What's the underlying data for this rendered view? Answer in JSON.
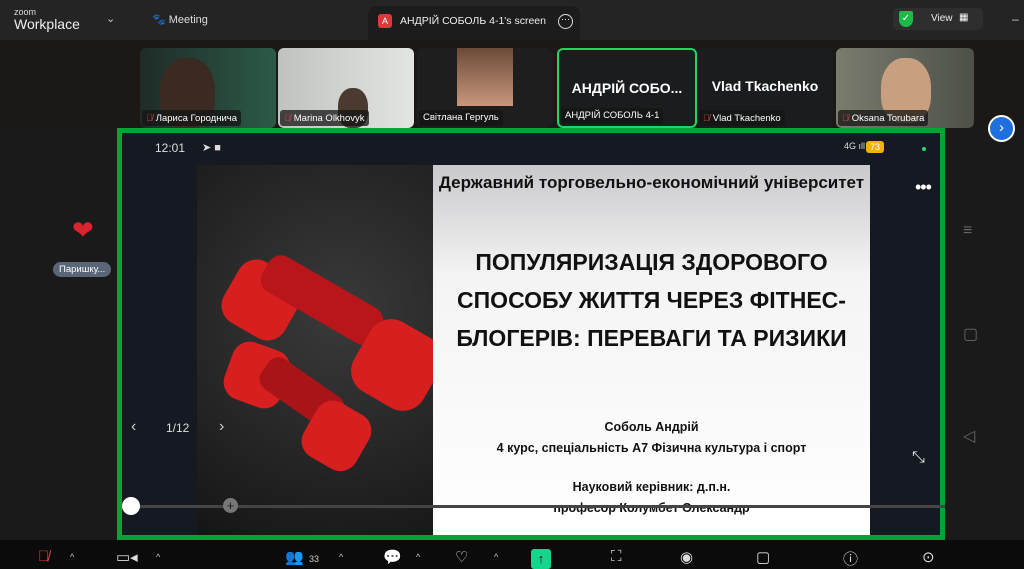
{
  "app": {
    "logo_top": "zoom",
    "logo_bottom": "Workplace",
    "meeting_label": "Meeting",
    "share_tab_badge": "A",
    "share_tab_title": "АНДРІЙ СОБОЛЬ 4-1's screen",
    "view_label": "View"
  },
  "participants": [
    {
      "name": "Лариса Городнича",
      "muted": true
    },
    {
      "name": "Marina Olkhovyk",
      "muted": true
    },
    {
      "name": "Світлана Гергуль",
      "muted": false
    },
    {
      "name": "АНДРІЙ СОБОЛЬ 4-1",
      "display": "АНДРІЙ СОБО...",
      "muted": false,
      "active": true
    },
    {
      "name": "Vlad Tkachenko",
      "display": "Vlad Tkachenko",
      "muted": true
    },
    {
      "name": "Oksana Torubara",
      "muted": true
    }
  ],
  "phone": {
    "time": "12:01",
    "signal": "4G",
    "battery": "73"
  },
  "slide": {
    "university": "Державний торговельно-економічний університет",
    "title": "ПОПУЛЯРИЗАЦІЯ ЗДОРОВОГО СПОСОБУ ЖИТТЯ ЧЕРЕЗ ФІТНЕС-БЛОГЕРІВ: ПЕРЕВАГИ ТА РИЗИКИ",
    "author": "Соболь Андрій",
    "course": "4 курс, спеціальність  А7 Фізична культура і спорт",
    "supervisor_label": "Науковий керівник: д.п.н.",
    "supervisor": "професор Колумбет Олександр",
    "page": "1/12",
    "progress": 0.0
  },
  "reaction": {
    "label": "Паришку..."
  },
  "toolbar": {
    "participants_count": "33"
  },
  "colors": {
    "share_border": "#02a535",
    "active_tile": "#1ed760",
    "share_button": "#12d68a"
  }
}
